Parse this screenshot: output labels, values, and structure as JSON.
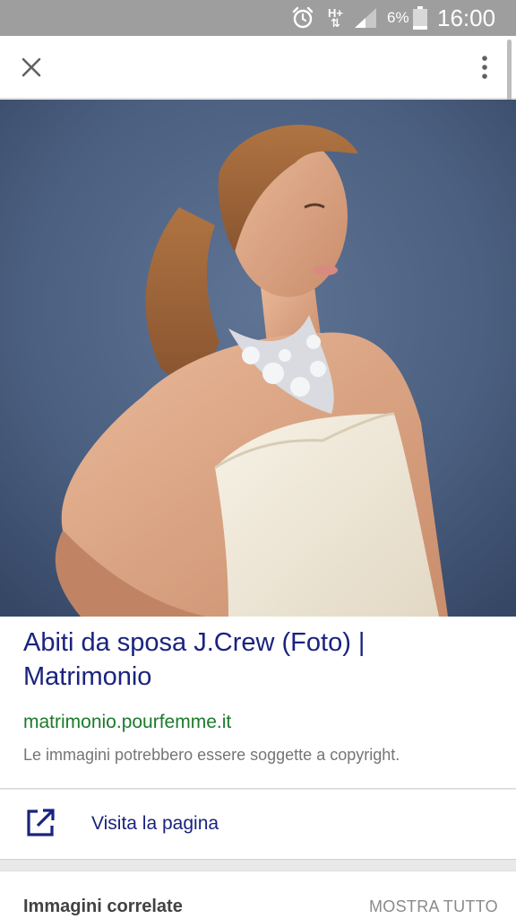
{
  "status_bar": {
    "network_top": "H+",
    "network_bottom": "⇅",
    "battery_percent": "6%",
    "time": "16:00",
    "icons": [
      "alarm-icon",
      "signal-icon",
      "battery-icon"
    ]
  },
  "app_bar": {
    "icons": [
      "close-icon",
      "more-vert-icon"
    ]
  },
  "result": {
    "title": "Abiti da sposa J.Crew (Foto) | Matrimonio",
    "domain": "matrimonio.pourfemme.it",
    "copyright_note": "Le immagini potrebbero essere soggette a copyright."
  },
  "visit": {
    "label": "Visita la pagina",
    "icon": "open-in-new-icon"
  },
  "related": {
    "title": "Immagini correlate",
    "more_label": "MOSTRA TUTTO"
  },
  "colors": {
    "link_blue": "#1a237e",
    "domain_green": "#1b7a2c",
    "status_bar": "#9e9e9e"
  }
}
